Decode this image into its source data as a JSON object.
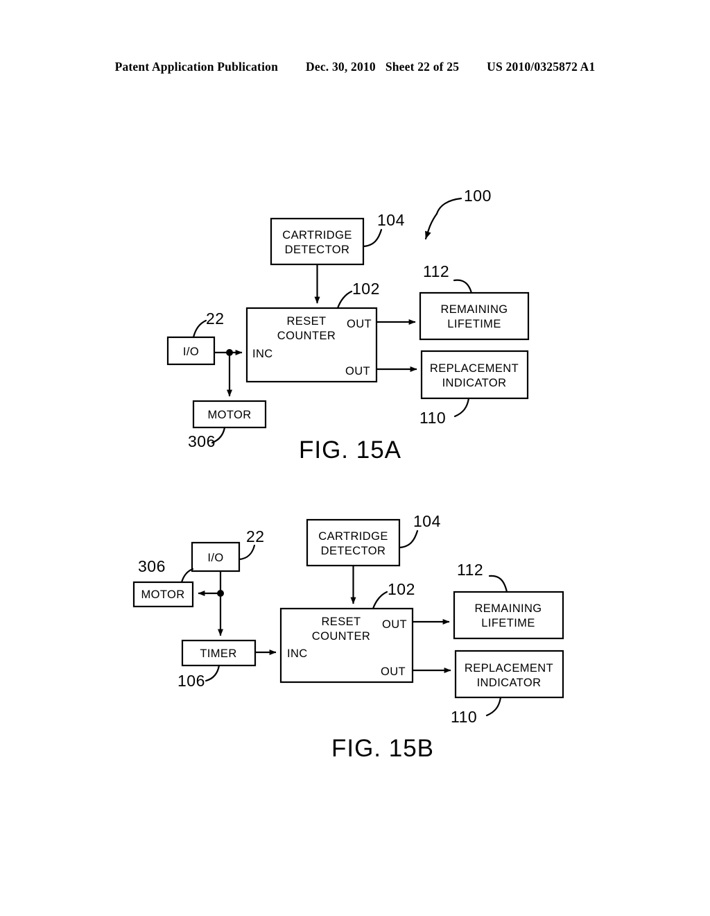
{
  "header": {
    "publication": "Patent Application Publication",
    "date": "Dec. 30, 2010",
    "sheet": "Sheet 22 of 25",
    "patent_number": "US 2010/0325872 A1"
  },
  "figures": [
    {
      "caption": "FIG. 15A",
      "system_ref": "100",
      "blocks": {
        "cartridge_detector": {
          "line1": "CARTRIDGE",
          "line2": "DETECTOR",
          "ref": "104"
        },
        "reset_counter": {
          "line1": "RESET",
          "line2": "COUNTER",
          "ref": "102",
          "port_inc": "INC",
          "port_out_top": "OUT",
          "port_out_bottom": "OUT"
        },
        "io": {
          "label": "I/O",
          "ref": "22"
        },
        "motor": {
          "label": "MOTOR",
          "ref": "306"
        },
        "remaining_lifetime": {
          "line1": "REMAINING",
          "line2": "LIFETIME",
          "ref": "112"
        },
        "replacement_indicator": {
          "line1": "REPLACEMENT",
          "line2": "INDICATOR",
          "ref": "110"
        }
      }
    },
    {
      "caption": "FIG. 15B",
      "blocks": {
        "cartridge_detector": {
          "line1": "CARTRIDGE",
          "line2": "DETECTOR",
          "ref": "104"
        },
        "reset_counter": {
          "line1": "RESET",
          "line2": "COUNTER",
          "ref": "102",
          "port_inc": "INC",
          "port_out_top": "OUT",
          "port_out_bottom": "OUT"
        },
        "io": {
          "label": "I/O",
          "ref": "22"
        },
        "motor": {
          "label": "MOTOR",
          "ref": "306"
        },
        "timer": {
          "label": "TIMER",
          "ref": "106"
        },
        "remaining_lifetime": {
          "line1": "REMAINING",
          "line2": "LIFETIME",
          "ref": "112"
        },
        "replacement_indicator": {
          "line1": "REPLACEMENT",
          "line2": "INDICATOR",
          "ref": "110"
        }
      }
    }
  ]
}
